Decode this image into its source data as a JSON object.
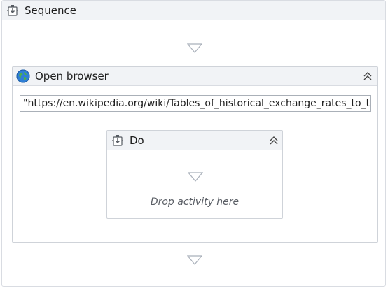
{
  "sequence": {
    "title": "Sequence",
    "icon": "sequence-icon"
  },
  "open_browser": {
    "title": "Open browser",
    "icon": "globe-icon",
    "url_value": "\"https://en.wikipedia.org/wiki/Tables_of_historical_exchange_rates_to_the_",
    "collapse_icon": "chevron-double-up-icon"
  },
  "do_block": {
    "title": "Do",
    "icon": "sequence-icon",
    "collapse_icon": "chevron-double-up-icon",
    "drop_hint": "Drop activity here"
  },
  "colors": {
    "header_bg": "#f1f3f6",
    "border": "#d9dce2",
    "arrow": "#a9b0ba",
    "hint_text": "#5b5f66"
  }
}
